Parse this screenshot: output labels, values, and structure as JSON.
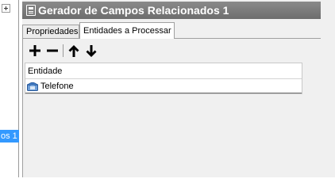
{
  "left_panel": {
    "selected_item": "os 1"
  },
  "window": {
    "title": "Gerador de Campos Relacionados 1"
  },
  "tabs": [
    {
      "label": "Propriedades",
      "active": false
    },
    {
      "label": "Entidades a Processar",
      "active": true
    }
  ],
  "toolbar": {
    "buttons": [
      "plus-icon",
      "minus-icon",
      "arrow-up-icon",
      "arrow-down-icon"
    ]
  },
  "grid": {
    "column": "Entidade",
    "rows": [
      {
        "label": "Telefone",
        "icon": "phone-icon"
      }
    ]
  }
}
